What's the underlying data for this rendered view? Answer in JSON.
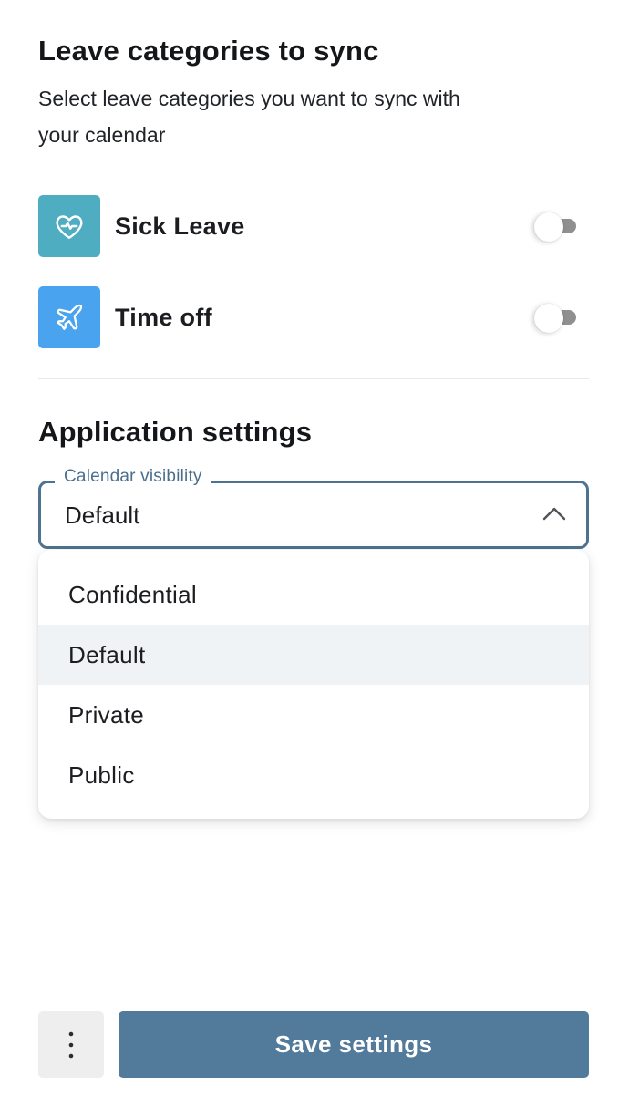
{
  "leave_section": {
    "title": "Leave categories to sync",
    "description": "Select leave categories you want to sync with your calendar",
    "categories": [
      {
        "label": "Sick Leave",
        "icon": "heart-pulse-icon",
        "color": "#4fadc2",
        "enabled": false
      },
      {
        "label": "Time off",
        "icon": "airplane-icon",
        "color": "#4aa3ef",
        "enabled": false
      }
    ]
  },
  "app_settings": {
    "title": "Application settings",
    "calendar_visibility": {
      "label": "Calendar visibility",
      "value": "Default",
      "expanded": true,
      "options": [
        "Confidential",
        "Default",
        "Private",
        "Public"
      ]
    }
  },
  "footer": {
    "more_icon": "more-vertical-icon",
    "save_label": "Save settings"
  },
  "colors": {
    "accent": "#527a9b",
    "select_border": "#4d7391",
    "toggle_track": "#8f8f8f"
  }
}
